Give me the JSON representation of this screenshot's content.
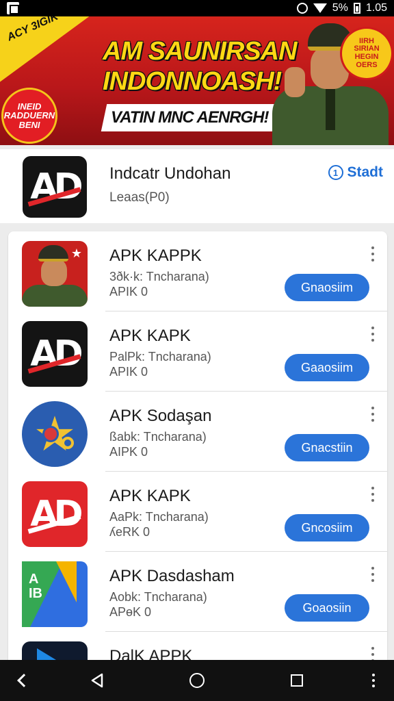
{
  "status_bar": {
    "battery_text": "5%",
    "time": "1.05"
  },
  "banner": {
    "corner_text": "ACY 3IGIK",
    "left_badge": "INEID\nRADDUERN\nBENI",
    "headline_1": "AM SAUNIRSAN",
    "headline_2": "INDONNOASH!",
    "subheadline": "VATIN MNC AENRGH!",
    "right_badge": "IIRH\nSIRIAN\nHEGIN\nOERS"
  },
  "top_app": {
    "title": "Indcatr Undohan",
    "subtitle": "Leaas(P0)",
    "action_label": "Stadt",
    "action_icon": "1"
  },
  "list": [
    {
      "title": "APK KAPPK",
      "line1": "3ðk·k: Tncharana)",
      "line2": "APIK 0",
      "button": "Gnaosiim",
      "icon": "soldier-icon"
    },
    {
      "title": "APK KAPK",
      "line1": "PalPk: Tncharana)",
      "line2": "APIK 0",
      "button": "Gaaosiim",
      "icon": "ad-logo-icon"
    },
    {
      "title": "APK Sodaşan",
      "line1": "ßabk: Tncharana)",
      "line2": "AIPK 0",
      "button": "Gnacstiin",
      "icon": "star-badge-icon"
    },
    {
      "title": "APK KAPK",
      "line1": "AaPk: Tncharana)",
      "line2": "ʎeRK 0",
      "button": "Gncosiim",
      "icon": "ad-red-logo-icon"
    },
    {
      "title": "APK Dasdasham",
      "line1": "Aobk: Tncharana)",
      "line2": "APɵK 0",
      "button": "Goaosiin",
      "icon": "ab-folder-icon"
    },
    {
      "title": "DalK APPK",
      "line1": "",
      "line2": "",
      "button": "",
      "icon": "play-icon"
    }
  ],
  "icon_text": {
    "ad": "AD",
    "ab": "A\nIB"
  },
  "colors": {
    "accent_blue": "#2b74d9",
    "banner_red": "#d6241c",
    "banner_yellow": "#ffd814"
  }
}
